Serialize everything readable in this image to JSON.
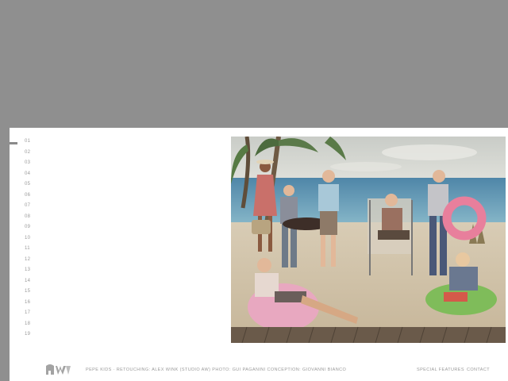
{
  "sidebar": {
    "numbers": [
      "01",
      "02",
      "03",
      "04",
      "05",
      "06",
      "07",
      "08",
      "09",
      "10",
      "11",
      "12",
      "13",
      "14",
      "15",
      "16",
      "17",
      "18",
      "19"
    ]
  },
  "footer": {
    "credits": "PEPE KIDS · RETOUCHING: ALEX WINK (STUDIO AW) PHOTO: GUI PAGANINI  CONCEPTION: GIOVANNI BIANCO",
    "special_features": "SPECIAL FEATURES",
    "contact": "CONTACT"
  },
  "colors": {
    "page_background": "#8f8f8f",
    "panel_background": "#ffffff",
    "muted_text": "#9a9a9a"
  }
}
